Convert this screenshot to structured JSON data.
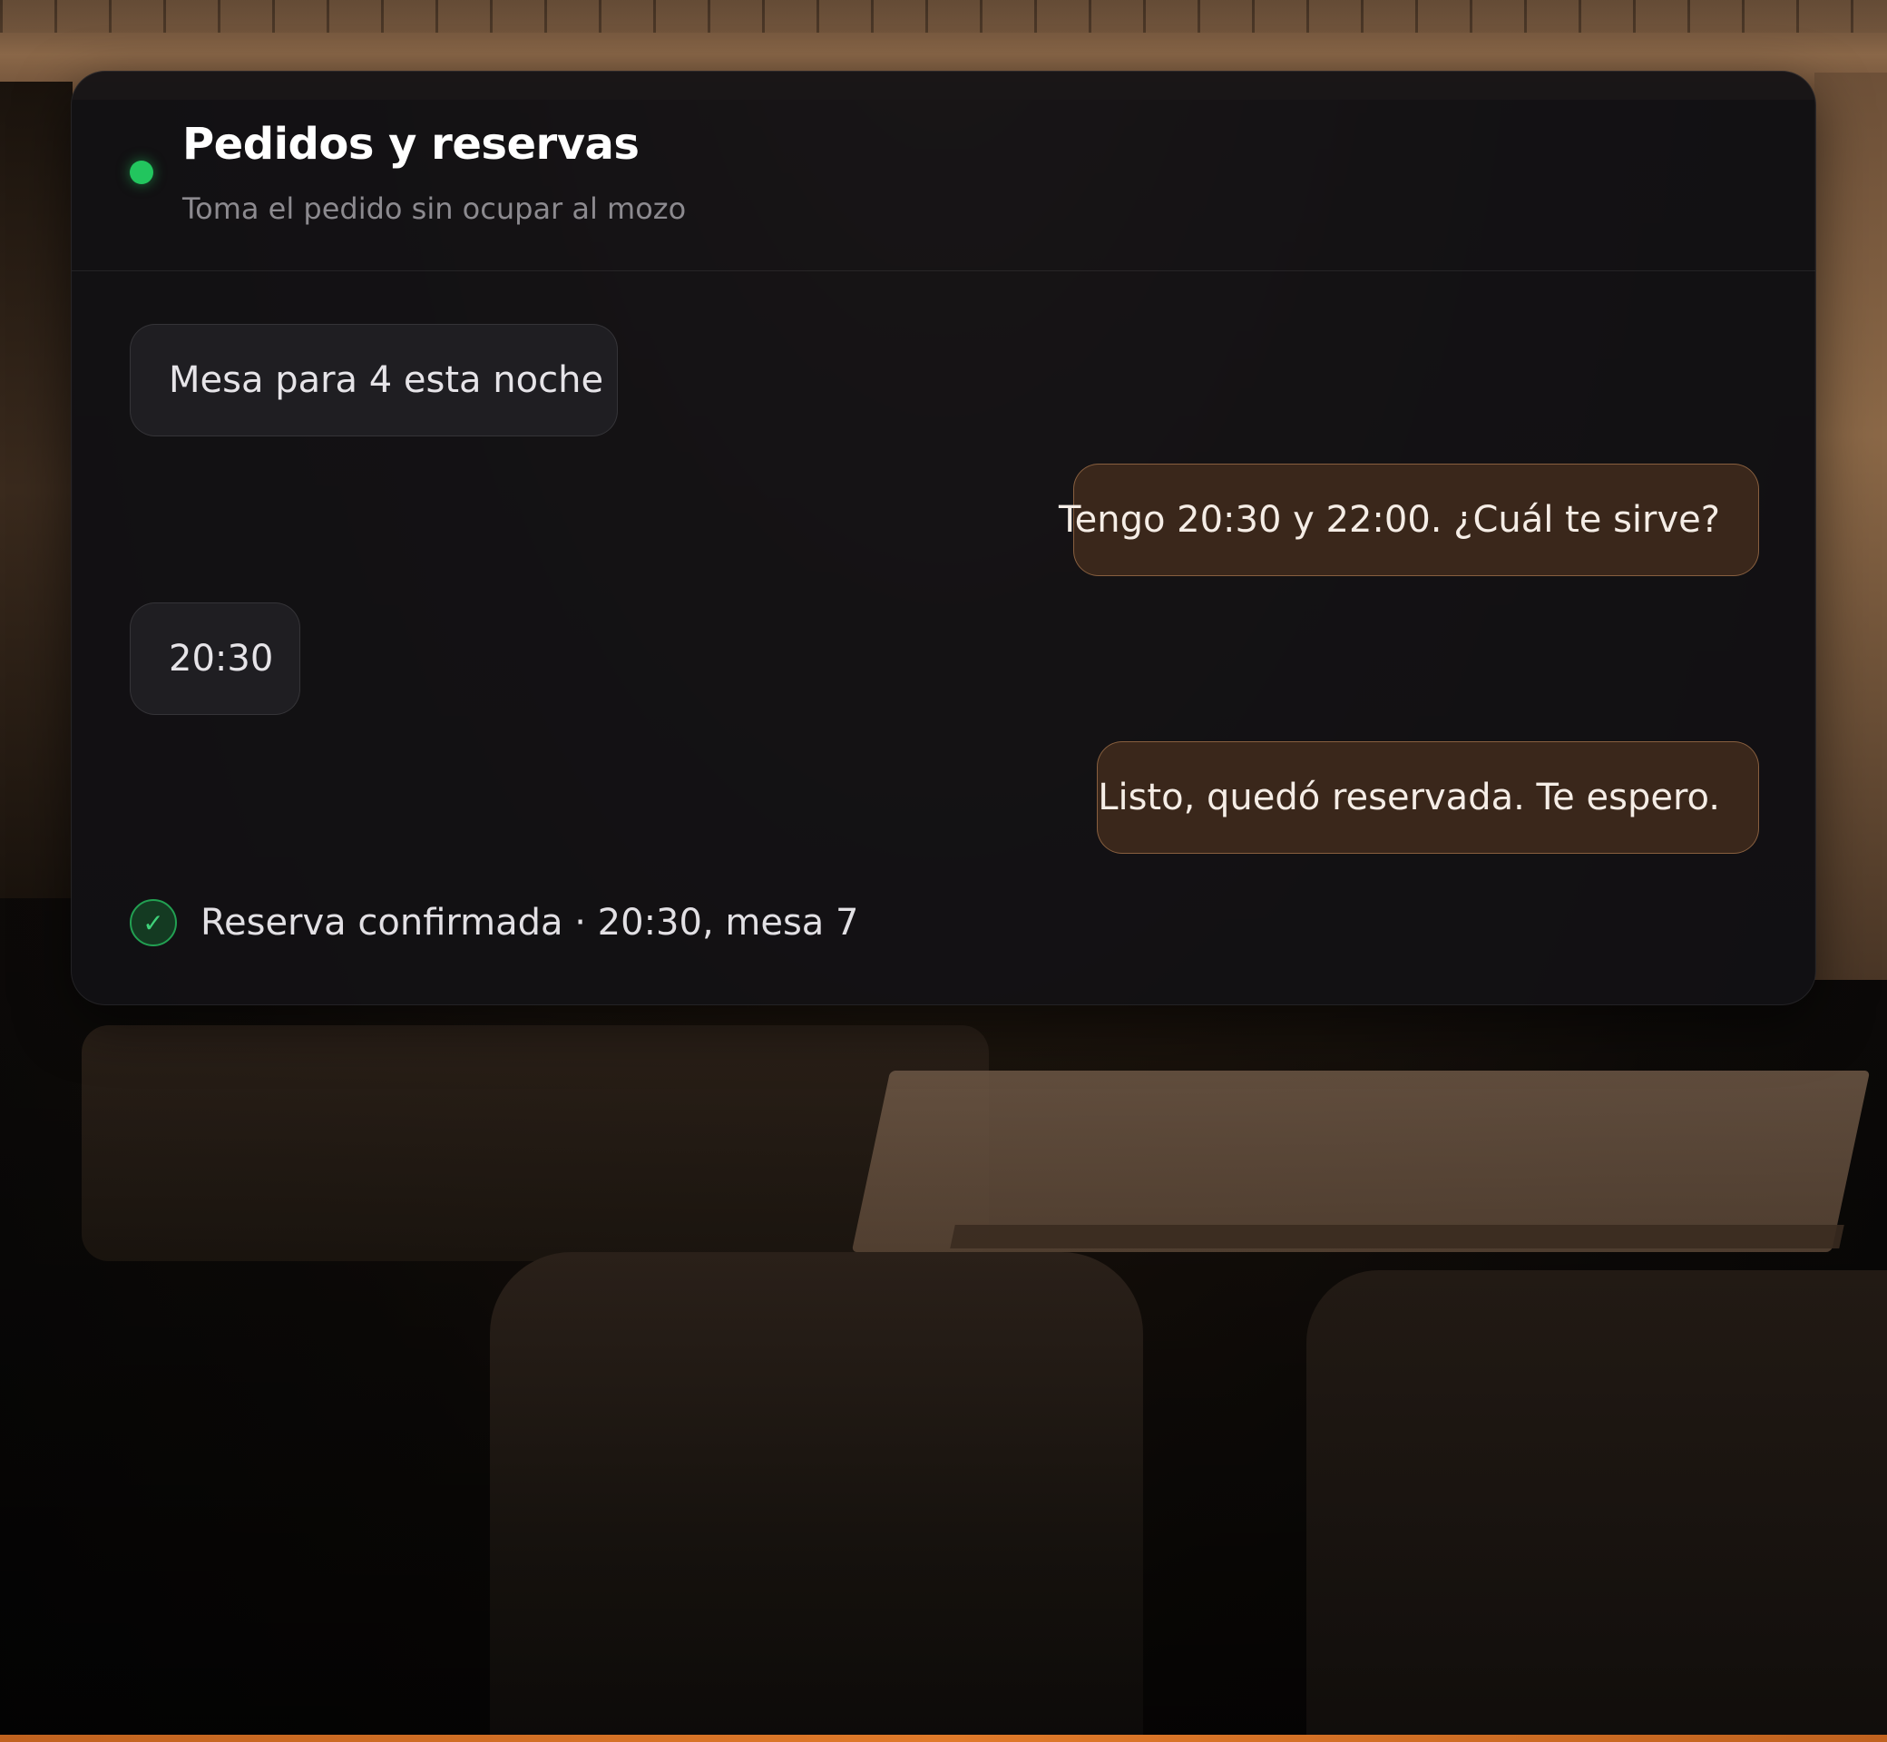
{
  "header": {
    "title": "Pedidos y reservas",
    "subtitle": "Toma el pedido sin ocupar al mozo",
    "status_color": "#22c55e"
  },
  "messages": [
    {
      "from": "customer",
      "text": "Mesa para 4 esta noche"
    },
    {
      "from": "assistant",
      "text": "Tengo 20:30 y 22:00. ¿Cuál te sirve?"
    },
    {
      "from": "customer",
      "text": "20:30"
    },
    {
      "from": "assistant",
      "text": "Listo, quedó reservada. Te espero."
    }
  ],
  "confirmation": {
    "icon": "check-circle-icon",
    "text": "Reserva confirmada · 20:30, mesa 7"
  },
  "colors": {
    "accent": "#e07a2a",
    "assistant_bubble": "#3a271b",
    "customer_bubble": "#1f1e22",
    "success": "#22a052"
  }
}
